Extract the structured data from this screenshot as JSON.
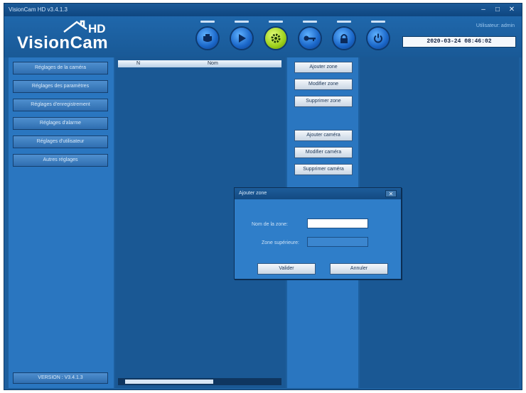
{
  "window": {
    "title": "VisionCam HD v3.4.1.3",
    "minimize": "–",
    "maximize": "□",
    "close": "✕"
  },
  "logo": {
    "brand": "VisionCam",
    "suffix": "HD"
  },
  "toolbar": [
    {
      "icon": "camera-icon",
      "active": false
    },
    {
      "icon": "play-icon",
      "active": false
    },
    {
      "icon": "gear-icon",
      "active": true
    },
    {
      "icon": "key-icon",
      "active": false
    },
    {
      "icon": "lock-icon",
      "active": false
    },
    {
      "icon": "power-icon",
      "active": false
    }
  ],
  "user": {
    "label": "Utilisateur: admin",
    "clock": "2020-03-24 08:46:02"
  },
  "sidebar": {
    "items": [
      {
        "label": "Réglages de la caméra"
      },
      {
        "label": "Réglages des paramètres"
      },
      {
        "label": "Réglages d'enregistrement"
      },
      {
        "label": "Réglages d'alarme"
      },
      {
        "label": "Réglages d'utilisateur"
      },
      {
        "label": "Autres réglages"
      }
    ],
    "version": "VERSION : V3.4.1.3"
  },
  "list": {
    "columns": [
      "N",
      "Nom"
    ]
  },
  "actions": [
    {
      "label": "Ajouter zone"
    },
    {
      "label": "Modifier zone"
    },
    {
      "label": "Supprimer zone"
    },
    {
      "label": "Ajouter caméra"
    },
    {
      "label": "Modifier caméra"
    },
    {
      "label": "Supprimer caméra"
    }
  ],
  "dialog": {
    "title": "Ajouter zone",
    "close": "✕",
    "zone_name_label": "Nom de la zone:",
    "zone_name_value": "",
    "parent_zone_label": "Zone supérieure:",
    "parent_zone_value": "",
    "ok": "Valider",
    "cancel": "Annuler"
  },
  "colors": {
    "accent": "#9ccf1a",
    "panel": "#2a76c0",
    "dark_panel": "#1a5894"
  }
}
